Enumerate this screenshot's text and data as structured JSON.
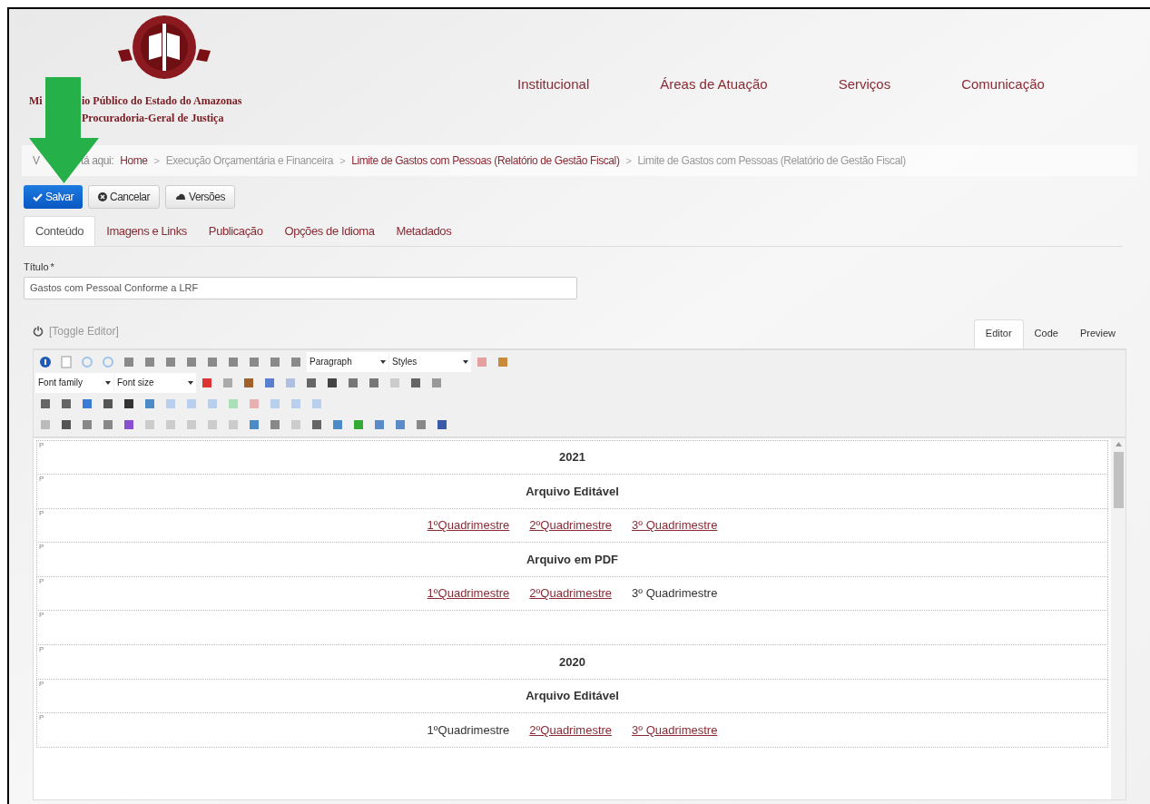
{
  "header": {
    "org_line1_parts": [
      "Mi",
      "io Público do Estado do Amazonas"
    ],
    "org_line2": "Procuradoria-Geral de Justiça"
  },
  "nav": [
    "Institucional",
    "Áreas de Atuação",
    "Serviços",
    "Comunicação"
  ],
  "breadcrumb": {
    "prefix_parts": [
      "V",
      "tá aqui:"
    ],
    "separator": ">",
    "items": [
      {
        "text": "Home",
        "link": true
      },
      {
        "text": "Execução Orçamentária e Financeira",
        "link": false
      },
      {
        "text": "Limite de Gastos com Pessoas (Relatório de Gestão Fiscal)",
        "link": true
      },
      {
        "text": "Limite de Gastos com Pessoas (Relatório de Gestão Fiscal)",
        "link": false
      }
    ]
  },
  "actions": [
    {
      "label": "Salvar",
      "kind": "primary"
    },
    {
      "label": "Cancelar",
      "kind": "cancel"
    },
    {
      "label": "Versões",
      "kind": "versions"
    }
  ],
  "tabs": [
    {
      "label": "Conteúdo",
      "selected": true
    },
    {
      "label": "Imagens e Links",
      "selected": false
    },
    {
      "label": "Publicação",
      "selected": false
    },
    {
      "label": "Opções de Idioma",
      "selected": false
    },
    {
      "label": "Metadados",
      "selected": false
    }
  ],
  "title_field": {
    "label": "Título",
    "required_mark": "*",
    "value": "Gastos com Pessoal Conforme a LRF"
  },
  "toggle_editor": "[Toggle Editor]",
  "editor_tabs": [
    {
      "label": "Editor",
      "selected": true
    },
    {
      "label": "Code",
      "selected": false
    },
    {
      "label": "Preview",
      "selected": false
    }
  ],
  "toolbar_selects": {
    "format": "Paragraph",
    "styles": "Styles",
    "font_family": "Font family",
    "font_size": "Font size"
  },
  "content_rows": [
    {
      "marker": "P",
      "kind": "heading",
      "text": "2021"
    },
    {
      "marker": "P",
      "kind": "heading",
      "text": "Arquivo Editável"
    },
    {
      "marker": "P",
      "kind": "links",
      "items": [
        {
          "text": "1ºQuadrimestre",
          "link": true
        },
        {
          "text": "2ºQuadrimestre",
          "link": true
        },
        {
          "text": "3º Quadrimestre",
          "link": true
        }
      ]
    },
    {
      "marker": "P",
      "kind": "heading",
      "text": "Arquivo em PDF"
    },
    {
      "marker": "P",
      "kind": "links",
      "items": [
        {
          "text": "1ºQuadrimestre",
          "link": true
        },
        {
          "text": "2ºQuadrimestre",
          "link": true
        },
        {
          "text": "3º Quadrimestre",
          "link": false
        }
      ]
    },
    {
      "marker": "P",
      "kind": "empty"
    },
    {
      "marker": "P",
      "kind": "heading",
      "text": "2020"
    },
    {
      "marker": "P",
      "kind": "heading",
      "text": "Arquivo Editável"
    },
    {
      "marker": "P",
      "kind": "links",
      "items": [
        {
          "text": "1ºQuadrimestre",
          "link": false
        },
        {
          "text": "2ºQuadrimestre",
          "link": true
        },
        {
          "text": "3º Quadrimestre",
          "link": true
        }
      ]
    }
  ]
}
